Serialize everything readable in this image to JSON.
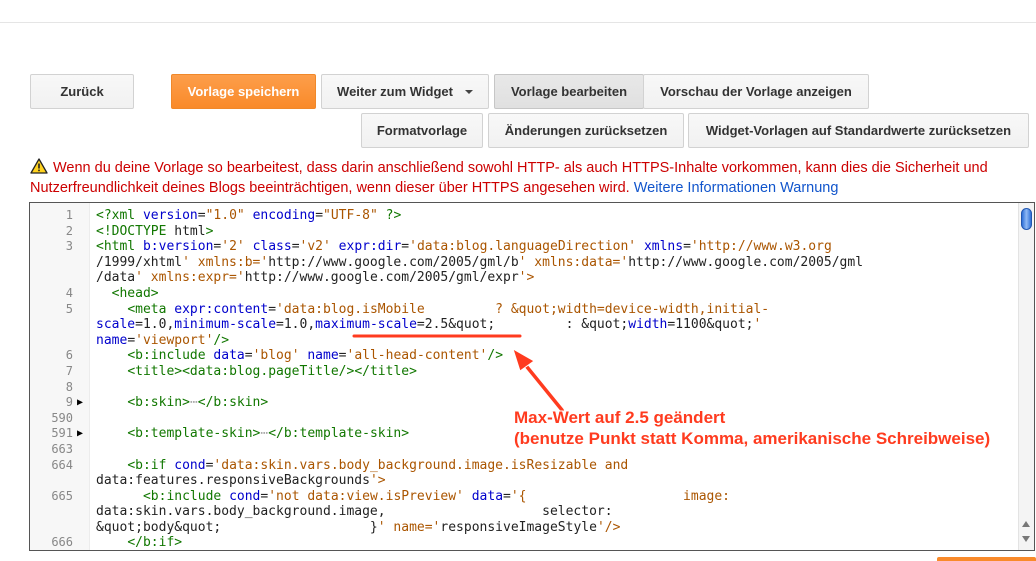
{
  "toolbar": {
    "back_label": "Zurück",
    "save_label": "Vorlage speichern",
    "widget_label": "Weiter zum Widget",
    "edit_label": "Vorlage bearbeiten",
    "preview_label": "Vorschau der Vorlage anzeigen",
    "format_label": "Formatvorlage",
    "reset_label": "Änderungen zurücksetzen",
    "widget_reset_label": "Widget-Vorlagen auf Standardwerte zurücksetzen"
  },
  "warning": {
    "text": "Wenn du deine Vorlage so bearbeitest, dass darin anschließend sowohl HTTP- als auch HTTPS-Inhalte vorkommen, kann dies die Sicherheit und Nutzerfreundlichkeit deines Blogs beeinträchtigen, wenn dieser über HTTPS angesehen wird.",
    "link_text": "Weitere Informationen Warnung",
    "icon": "warning-triangle-icon"
  },
  "editor": {
    "lines": [
      {
        "num": "1",
        "fold": "",
        "code": "<?xml version=\"1.0\" encoding=\"UTF-8\" ?>"
      },
      {
        "num": "2",
        "fold": "",
        "code": "<!DOCTYPE html>"
      },
      {
        "num": "3",
        "fold": "",
        "code": "<html b:version='2' class='v2' expr:dir='data:blog.languageDirection' xmlns='http://www.w3.org"
      },
      {
        "num": "",
        "fold": "",
        "code": "/1999/xhtml' xmlns:b='http://www.google.com/2005/gml/b' xmlns:data='http://www.google.com/2005/gml"
      },
      {
        "num": "",
        "fold": "",
        "code": "/data' xmlns:expr='http://www.google.com/2005/gml/expr'>"
      },
      {
        "num": "4",
        "fold": "",
        "code": "  <head>"
      },
      {
        "num": "5",
        "fold": "",
        "code": "    <meta expr:content='data:blog.isMobile         ? &quot;width=device-width,initial-"
      },
      {
        "num": "",
        "fold": "",
        "code": "scale=1.0,minimum-scale=1.0,maximum-scale=2.5&quot;         : &quot;width=1100&quot;'"
      },
      {
        "num": "",
        "fold": "",
        "code": "name='viewport'/>"
      },
      {
        "num": "6",
        "fold": "",
        "code": "    <b:include data='blog' name='all-head-content'/>"
      },
      {
        "num": "7",
        "fold": "",
        "code": "    <title><data:blog.pageTitle/></title>"
      },
      {
        "num": "8",
        "fold": "",
        "code": ""
      },
      {
        "num": "9",
        "fold": "▶",
        "code": "    <b:skin>⋯</b:skin>"
      },
      {
        "num": "590",
        "fold": "",
        "code": ""
      },
      {
        "num": "591",
        "fold": "▶",
        "code": "    <b:template-skin>⋯</b:template-skin>"
      },
      {
        "num": "663",
        "fold": "",
        "code": ""
      },
      {
        "num": "664",
        "fold": "",
        "code": "    <b:if cond='data:skin.vars.body_background.image.isResizable and"
      },
      {
        "num": "",
        "fold": "",
        "code": "data:features.responsiveBackgrounds'>"
      },
      {
        "num": "665",
        "fold": "",
        "code": "      <b:include cond='not data:view.isPreview' data='{                    image:"
      },
      {
        "num": "",
        "fold": "",
        "code": "data:skin.vars.body_background.image,                    selector:"
      },
      {
        "num": "",
        "fold": "",
        "code": "&quot;body&quot;                   }' name='responsiveImageStyle'/>"
      },
      {
        "num": "666",
        "fold": "",
        "code": "    </b:if>"
      }
    ]
  },
  "annotation": {
    "line1": "Max-Wert auf 2.5 geändert",
    "line2": "(benutze Punkt statt Komma, amerikanische Schreibweise)",
    "color": "#ff3b1f"
  },
  "colors": {
    "primary_button": "#f98a2a",
    "warning_text": "#cc0000",
    "link": "#1155cc",
    "xml_tag": "#117700",
    "xml_attr": "#0000cc",
    "xml_string": "#aa5500"
  }
}
